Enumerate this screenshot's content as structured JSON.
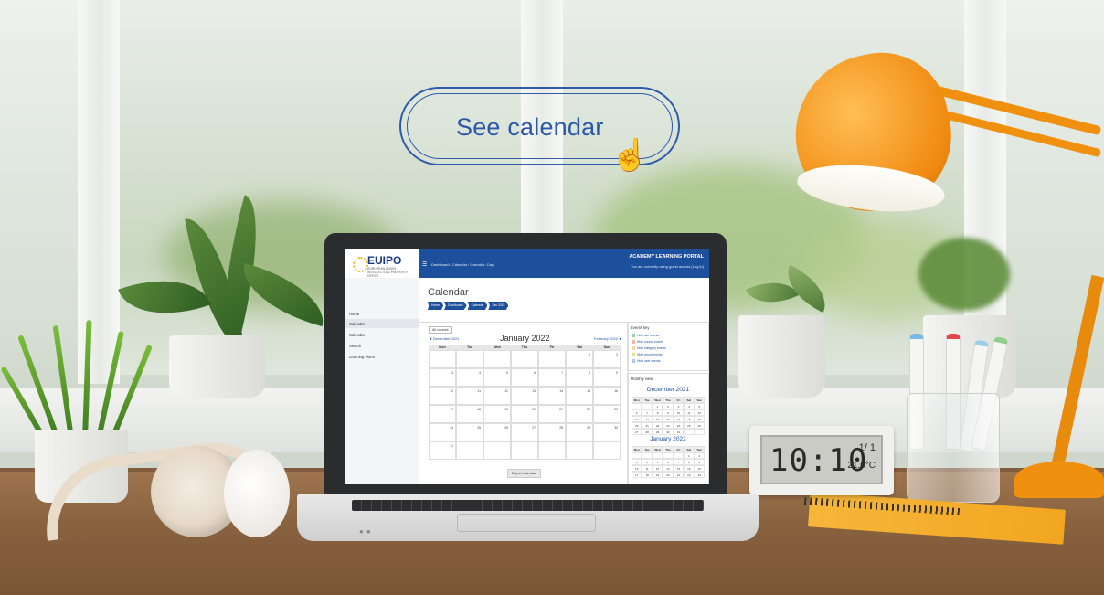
{
  "cta": {
    "label": "See calendar"
  },
  "lms": {
    "logo": "EUIPO",
    "logo_sub": "EUROPEAN UNION INTELLECTUAL PROPERTY OFFICE",
    "topbar": {
      "breadcrumb": "Dashboard / Calendar / Calendar: Day",
      "title": "ACADEMY LEARNING PORTAL",
      "login_status": "You are currently using guest access (Log in)"
    },
    "sidebar": [
      "Home",
      "Calendar",
      "Calendar",
      "Search",
      "Learning Plans"
    ],
    "page_title": "Calendar",
    "breadcrumbs": [
      "Home",
      "Dashboard",
      "Calendar",
      "Jan 2022"
    ],
    "calendar": {
      "filter_button": "All courses",
      "prev_month": "◄ December 2021",
      "month": "January 2022",
      "next_month": "February 2022 ►",
      "weekdays": [
        "Mon",
        "Tue",
        "Wed",
        "Thu",
        "Fri",
        "Sat",
        "Sun"
      ],
      "weeks": [
        [
          "",
          "",
          "",
          "",
          "",
          "1",
          "2"
        ],
        [
          "3",
          "4",
          "5",
          "6",
          "7",
          "8",
          "9"
        ],
        [
          "10",
          "11",
          "12",
          "13",
          "14",
          "15",
          "16"
        ],
        [
          "17",
          "18",
          "19",
          "20",
          "21",
          "22",
          "23"
        ],
        [
          "24",
          "25",
          "26",
          "27",
          "28",
          "29",
          "30"
        ],
        [
          "31",
          "",
          "",
          "",
          "",
          "",
          ""
        ]
      ],
      "export_button": "Export calendar"
    },
    "events_key": {
      "title": "Events key",
      "items": [
        "Hide site events",
        "Hide course events",
        "Hide category events",
        "Hide group events",
        "Hide user events"
      ]
    },
    "monthly_view": {
      "title": "Monthly view",
      "month1": "December 2021",
      "month2": "January 2022",
      "weekdays_short": [
        "Mon",
        "Tue",
        "Wed",
        "Thu",
        "Fri",
        "Sat",
        "Sun"
      ],
      "dec_days": [
        "",
        "",
        "1",
        "2",
        "3",
        "4",
        "5",
        "6",
        "7",
        "8",
        "9",
        "10",
        "11",
        "12",
        "13",
        "14",
        "15",
        "16",
        "17",
        "18",
        "19",
        "20",
        "21",
        "22",
        "23",
        "24",
        "25",
        "26",
        "27",
        "28",
        "29",
        "30",
        "31",
        "",
        ""
      ],
      "jan_days": [
        "",
        "",
        "",
        "",
        "",
        "1",
        "2",
        "3",
        "4",
        "5",
        "6",
        "7",
        "8",
        "9",
        "10",
        "11",
        "12",
        "13",
        "14",
        "15",
        "16",
        "17",
        "18",
        "19",
        "20",
        "21",
        "22",
        "23"
      ]
    }
  },
  "clock": {
    "time": "10:10",
    "date": "1/ 1",
    "temp": "21.0°C"
  }
}
